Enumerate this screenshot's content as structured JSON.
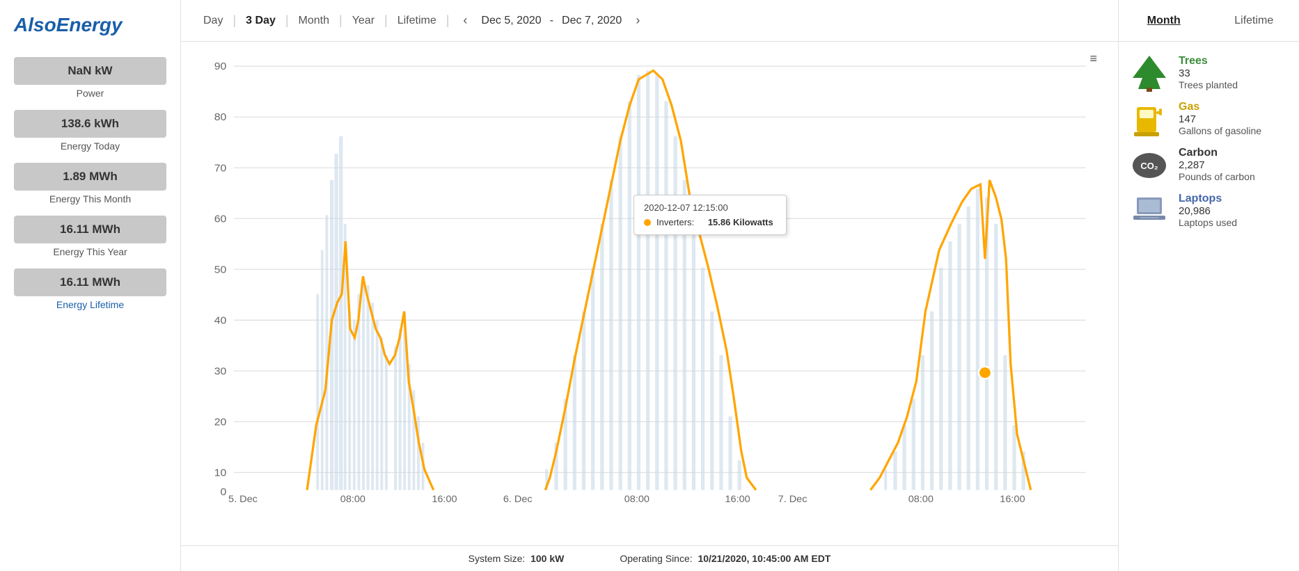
{
  "logo": {
    "text": "AlsoEnergy"
  },
  "nav": {
    "items": [
      {
        "label": "Day",
        "active": false
      },
      {
        "label": "3 Day",
        "active": true
      },
      {
        "label": "Month",
        "active": false
      },
      {
        "label": "Year",
        "active": false
      },
      {
        "label": "Lifetime",
        "active": false
      }
    ],
    "date_start": "Dec 5, 2020",
    "date_end": "Dec 7, 2020"
  },
  "sidebar": {
    "stats": [
      {
        "value": "NaN kW",
        "label": "Power",
        "label_blue": false
      },
      {
        "value": "138.6 kWh",
        "label": "Energy Today",
        "label_blue": false
      },
      {
        "value": "1.89 MWh",
        "label": "Energy This Month",
        "label_blue": false
      },
      {
        "value": "16.11 MWh",
        "label": "Energy This Year",
        "label_blue": false
      },
      {
        "value": "16.11 MWh",
        "label_prefix": "Energy ",
        "label_suffix": "Lifetime",
        "label_blue": true,
        "label": "Energy Lifetime"
      }
    ]
  },
  "chart": {
    "y_labels": [
      "0",
      "10",
      "20",
      "30",
      "40",
      "50",
      "60",
      "70",
      "80",
      "90"
    ],
    "x_labels": [
      "5. Dec",
      "08:00",
      "16:00",
      "6. Dec",
      "08:00",
      "16:00",
      "7. Dec",
      "08:00",
      "16:00"
    ],
    "menu_icon": "≡"
  },
  "tooltip": {
    "date": "2020-12-07 12:15:00",
    "label": "Inverters:",
    "value": "15.86 Kilowatts"
  },
  "bottom": {
    "system_size_label": "System Size:",
    "system_size_value": "100 kW",
    "operating_since_label": "Operating Since:",
    "operating_since_value": "10/21/2020, 10:45:00 AM EDT"
  },
  "right_panel": {
    "tabs": [
      {
        "label": "Month",
        "active": true
      },
      {
        "label": "Lifetime",
        "active": false
      }
    ],
    "eco_items": [
      {
        "icon": "tree",
        "title": "Trees",
        "value": "33",
        "desc": "Trees planted",
        "color": "green"
      },
      {
        "icon": "gas",
        "title": "Gas",
        "value": "147",
        "desc": "Gallons of gasoline",
        "color": "yellow"
      },
      {
        "icon": "co2",
        "title": "Carbon",
        "value": "2,287",
        "desc": "Pounds of carbon",
        "color": "dark"
      },
      {
        "icon": "laptop",
        "title": "Laptops",
        "value": "20,986",
        "desc": "Laptops used",
        "color": "blue"
      }
    ]
  }
}
